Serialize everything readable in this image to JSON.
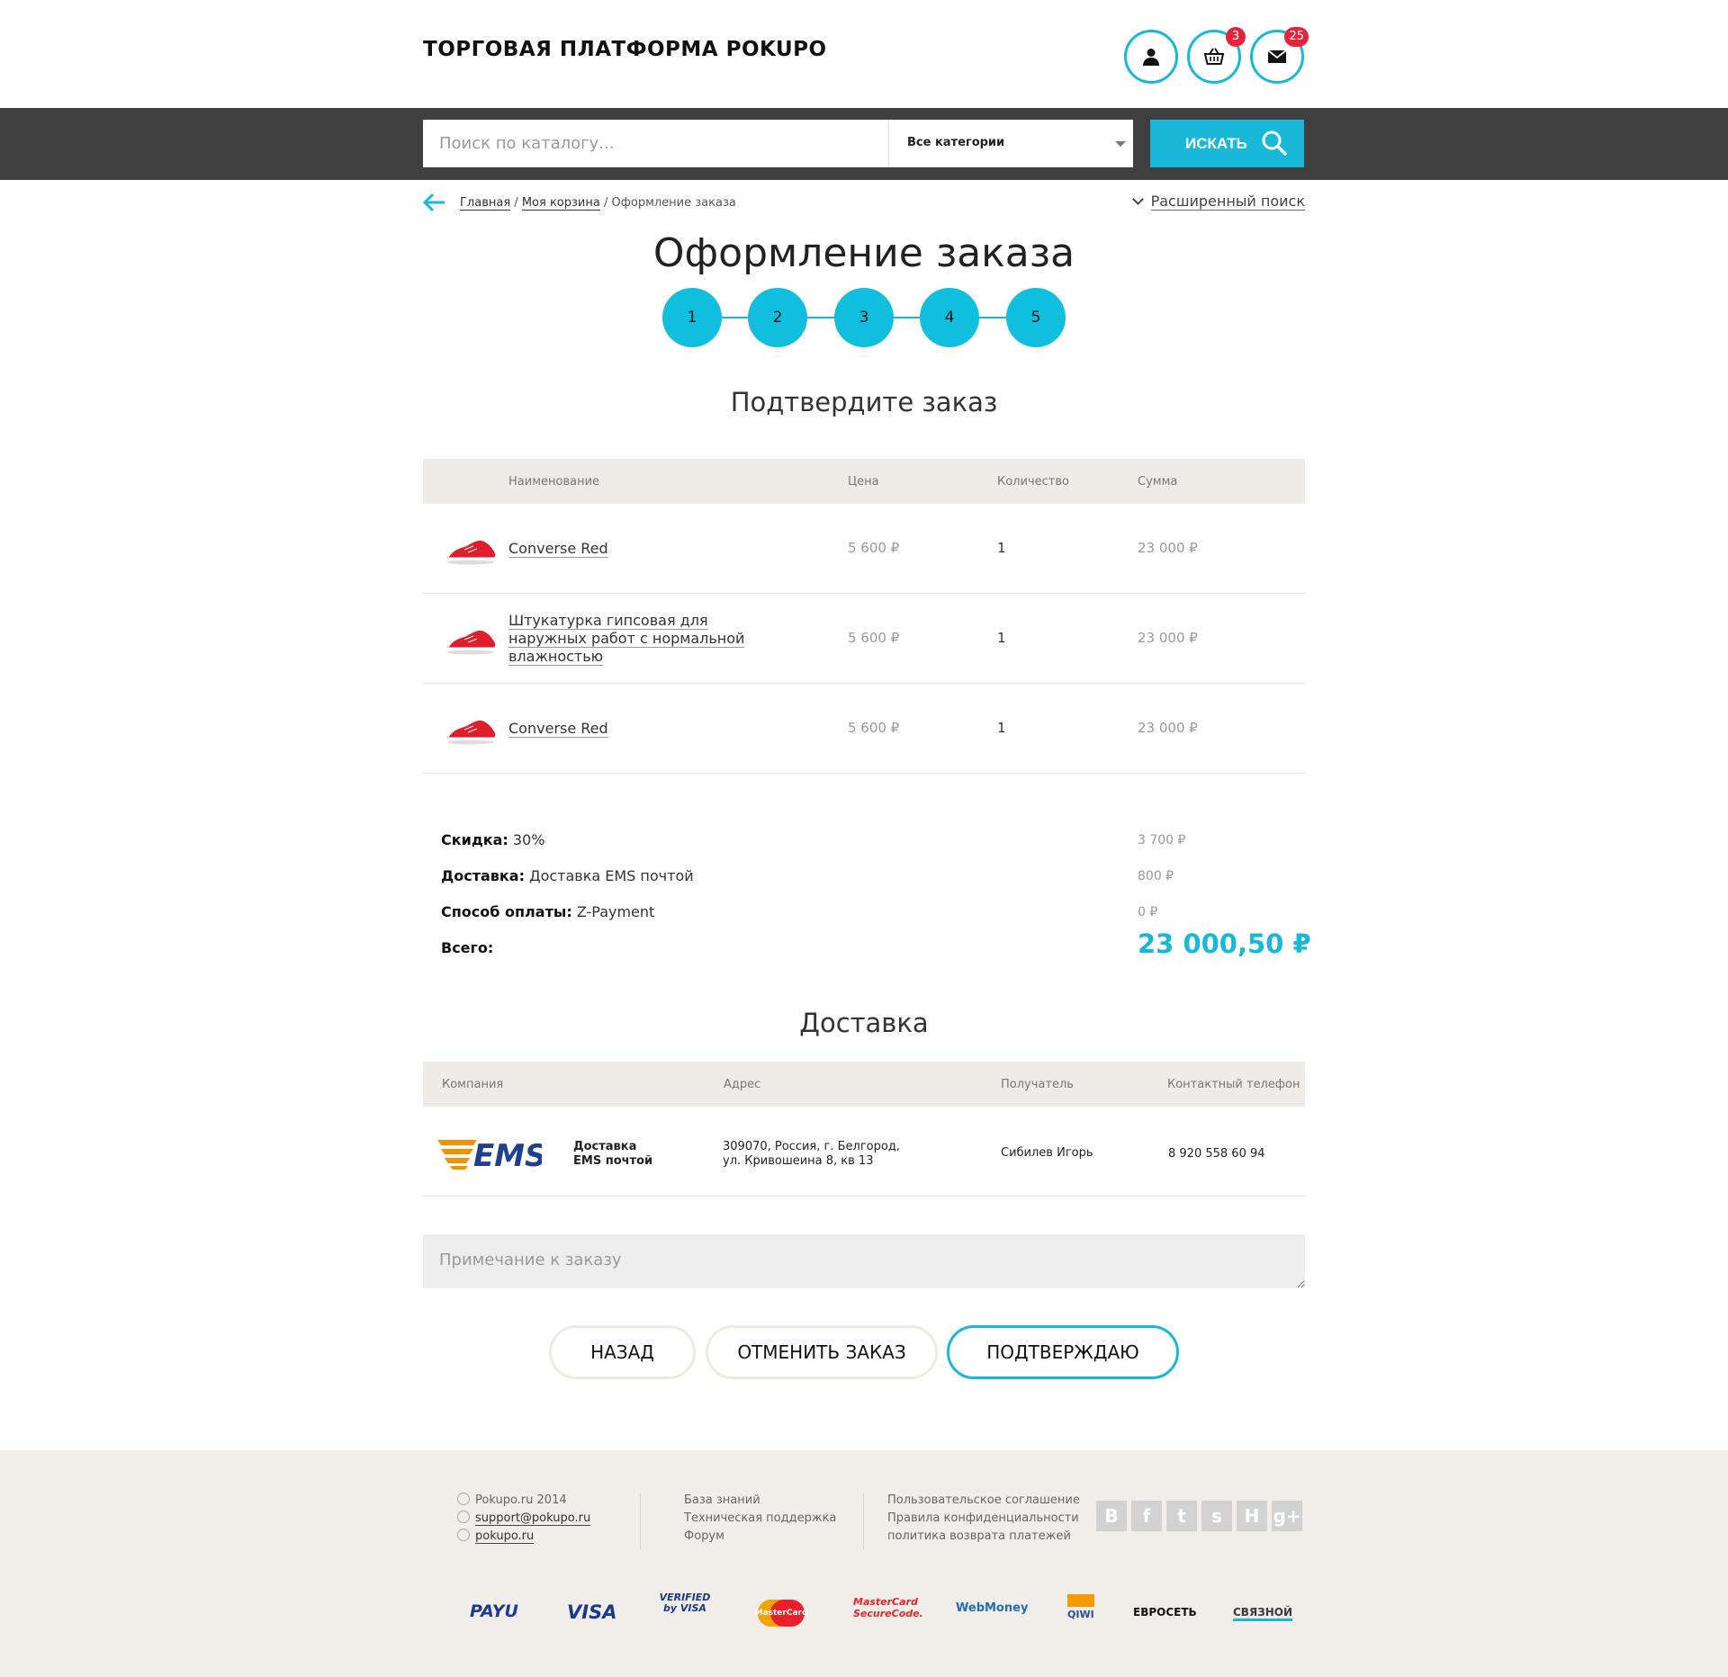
{
  "header": {
    "logo": "ТОРГОВАЯ ПЛАТФОРМА POKUPO",
    "cart_count": "3",
    "messages_count": "25"
  },
  "search": {
    "placeholder": "Поиск по каталогу...",
    "category": "Все категории",
    "button": "ИСКАТЬ"
  },
  "breadcrumb": {
    "home": "Главная",
    "sep": "/",
    "cart": "Моя корзина",
    "current": "Оформление заказа"
  },
  "advanced_search": "Расширенный поиск",
  "page_title": "Оформление заказа",
  "steps": [
    "1",
    "2",
    "3",
    "4",
    "5"
  ],
  "confirm_title": "Подтвердите заказ",
  "items_table": {
    "headers": {
      "name": "Наименование",
      "price": "Цена",
      "qty": "Количество",
      "sum": "Сумма"
    },
    "rows": [
      {
        "name": "Converse Red",
        "price": "5 600 ₽",
        "qty": "1",
        "sum": "23 000 ₽"
      },
      {
        "name": "Штукатурка гипсовая для наружных работ с нормальной влажностью",
        "price": "5 600 ₽",
        "qty": "1",
        "sum": "23 000 ₽"
      },
      {
        "name": "Converse Red",
        "price": "5 600 ₽",
        "qty": "1",
        "sum": "23 000 ₽"
      }
    ]
  },
  "totals": {
    "discount_label": "Скидка:",
    "discount_value": "30%",
    "discount_amount": "3 700 ₽",
    "delivery_label": "Доставка:",
    "delivery_value": "Доставка EMS почтой",
    "delivery_amount": "800 ₽",
    "payment_label": "Способ оплаты:",
    "payment_value": "Z-Payment",
    "payment_amount": "0 ₽",
    "total_label": "Всего:",
    "total_amount": "23 000,50 ₽"
  },
  "delivery_title": "Доставка",
  "delivery_table": {
    "headers": {
      "company": "Компания",
      "address": "Адрес",
      "recipient": "Получатель",
      "phone": "Контактный телефон"
    },
    "row": {
      "logo_text": "EMS",
      "company_line1": "Доставка",
      "company_line2": "EMS почтой",
      "address_line1": "309070, Россия, г. Белгород,",
      "address_line2": "ул. Кривошеина 8, кв 13",
      "recipient": "Сибилев Игорь",
      "phone": "8 920 558 60 94"
    }
  },
  "note_placeholder": "Примечание к заказу",
  "buttons": {
    "back": "НАЗАД",
    "cancel": "ОТМЕНИТЬ ЗАКАЗ",
    "confirm": "ПОДТВЕРЖДАЮ"
  },
  "footer": {
    "copyright": "Pokupo.ru 2014",
    "email": "support@pokupo.ru",
    "skype": "pokupo.ru",
    "links1": [
      "База знаний",
      "Техническая поддержка",
      "Форум"
    ],
    "links2": [
      "Пользовательское соглашение",
      "Правила конфиденциальности",
      "политика возврата платежей"
    ],
    "social": [
      "B",
      "f",
      "t",
      "s",
      "H",
      "g+"
    ],
    "payments": [
      "PAYU",
      "VISA",
      "VERIFIED by VISA",
      "MasterCard",
      "MasterCard SecureCode.",
      "WebMoney",
      "QIWI",
      "ЕВРОСЕТЬ",
      "СВЯЗНОЙ"
    ]
  },
  "colors": {
    "accent": "#1ab8d8",
    "badge": "#e5243b",
    "bar": "#3f3f3f",
    "table_head": "#efebe6",
    "footer": "#f1ede8"
  },
  "icons": [
    "user-icon",
    "basket-icon",
    "mail-icon",
    "search-icon",
    "back-arrow-icon",
    "chevron-down-icon"
  ]
}
